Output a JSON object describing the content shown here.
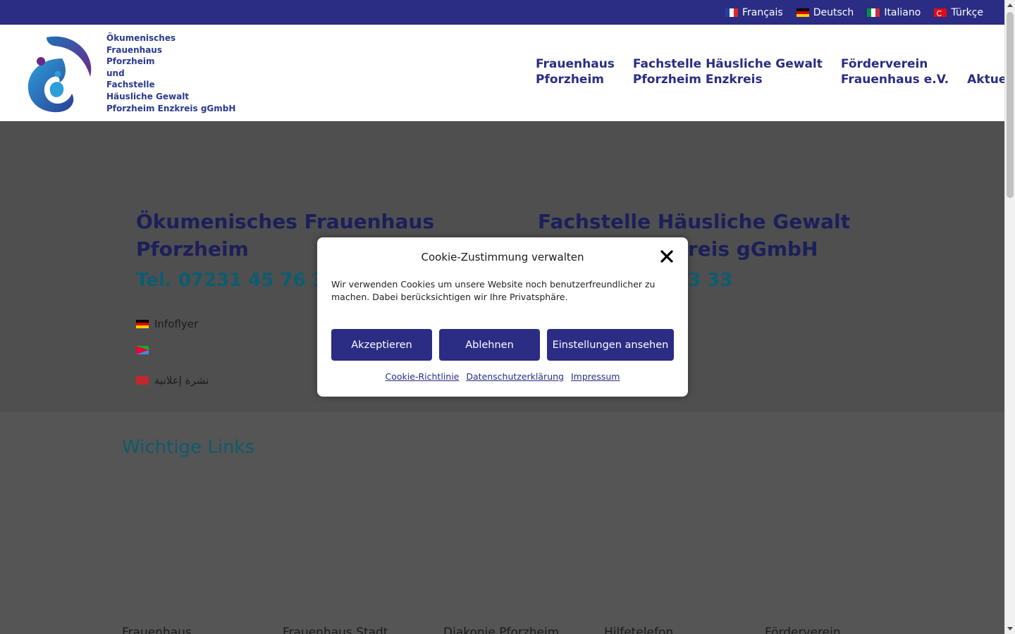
{
  "languages": [
    {
      "label": "Français",
      "icon": "flag-fr-icon"
    },
    {
      "label": "Deutsch",
      "icon": "flag-de-icon"
    },
    {
      "label": "Italiano",
      "icon": "flag-it-icon"
    },
    {
      "label": "Türkçe",
      "icon": "flag-tr-icon"
    }
  ],
  "logo": {
    "lines": [
      "Ökumenisches",
      "Frauenhaus",
      "Pforzheim",
      "und",
      "Fachstelle",
      "Häusliche Gewalt",
      "Pforzheim Enzkreis gGmbH"
    ]
  },
  "nav": [
    {
      "line1": "Frauenhaus",
      "line2": "Pforzheim"
    },
    {
      "line1": "Fachstelle Häusliche Gewalt",
      "line2": "Pforzheim Enzkreis"
    },
    {
      "line1": "Förderverein",
      "line2": "Frauenhaus e.V."
    },
    {
      "line1": "Aktuelles",
      "line2": ""
    }
  ],
  "content": {
    "left_title_1": "Ökumenisches Frauenhaus",
    "left_title_2": "Pforzheim",
    "left_tel": "Tel. 07231 45 76 30",
    "right_title_1": "Fachstelle Häusliche Gewalt",
    "right_title_2": "reis gGmbH",
    "right_tel": "3 33",
    "flyers": [
      {
        "label": "Infoflyer",
        "icon": "flag-de-icon"
      },
      {
        "label": "",
        "icon": "flag-er-icon"
      },
      {
        "label": "نشرة إعلانية",
        "icon": "flag-ar-icon"
      }
    ],
    "section_title": "Wichtige Links",
    "footer_links": [
      "Frauenhaus",
      "Frauenhaus Stadt",
      "Diakonie Pforzheim",
      "Hilfetelefon",
      "Förderverein"
    ]
  },
  "cookie": {
    "title": "Cookie-Zustimmung verwalten",
    "text": "Wir verwenden Cookies um unsere Website noch benutzerfreundlicher zu machen. Dabei berücksichtigen wir Ihre Privatsphäre.",
    "accept": "Akzeptieren",
    "deny": "Ablehnen",
    "settings": "Einstellungen ansehen",
    "links": [
      "Cookie-Richtlinie",
      "Datenschutzerklärung",
      "Impressum"
    ]
  },
  "colors": {
    "brand": "#2a2d83",
    "overlay": "#4f4f4f",
    "teal": "#0d5c70"
  }
}
